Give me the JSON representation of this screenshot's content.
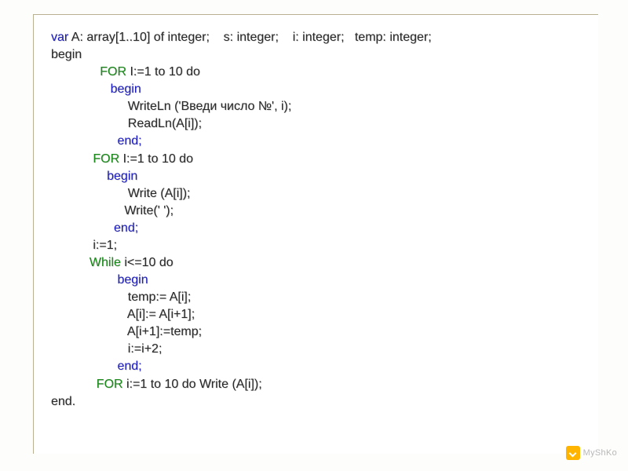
{
  "watermark": "МyShKo",
  "code": {
    "l0_a": "var",
    "l0_b": " A: array[1..10] of integer;    s: integer;    i: integer;   temp: integer;",
    "l1": "begin",
    "l2_a": "              FOR",
    "l2_b": " I:=1 to 10 do",
    "l3_a": "                 begin",
    "l4": "                      WriteLn ('Введи число №', i);",
    "l5": "                      ReadLn(A[i]);",
    "l6": "                   end;",
    "l7_a": "            FOR",
    "l7_b": " I:=1 to 10 do",
    "l8": "                begin",
    "l9": "                      Write (A[i]);",
    "l10": "                     Write(' ');",
    "l11": "                  end;",
    "l12": "            i:=1;",
    "l13_a": "           While",
    "l13_b": " i<=10 do",
    "l14": "                   begin",
    "l15": "                      temp:= A[i];",
    "l16": "                      A[i]:= A[i+1];",
    "l17": "                      A[i+1]:=temp;",
    "l18": "                      i:=i+2;",
    "l19": "                   end;",
    "l20_a": "             FOR",
    "l20_b": " i:=1 to 10 do Write (A[i]);",
    "l21": "end."
  }
}
